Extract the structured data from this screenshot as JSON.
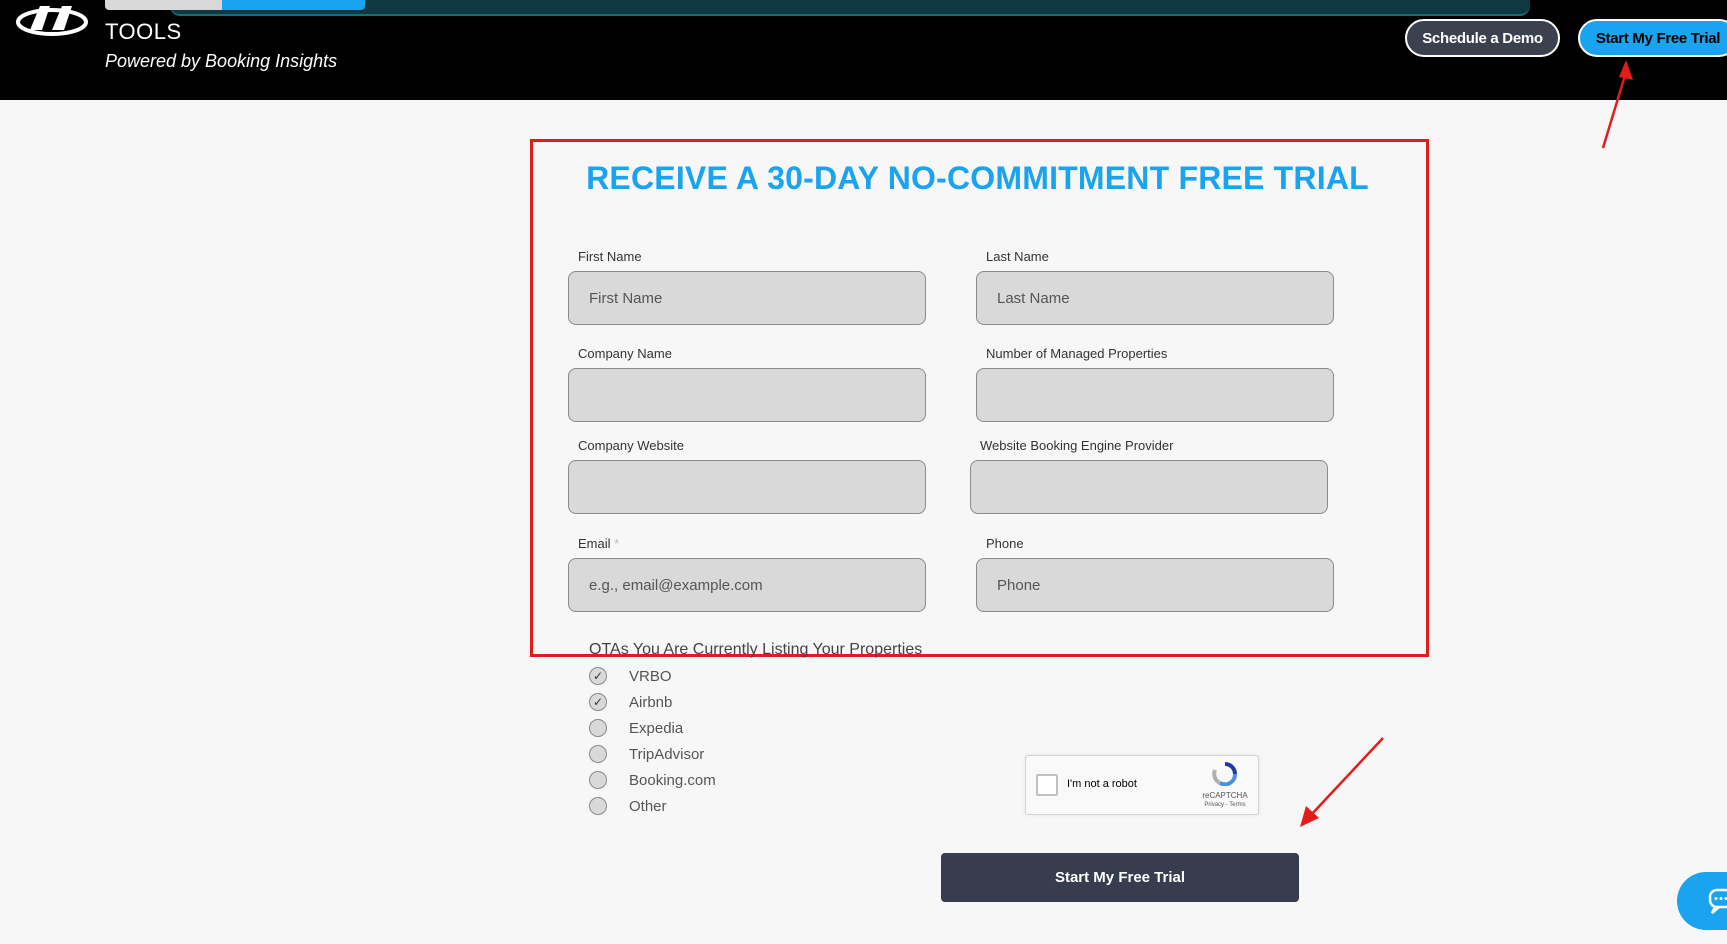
{
  "header": {
    "brand_tools": "TOOLS",
    "tagline": "Powered by Booking Insights",
    "schedule_demo_label": "Schedule a Demo",
    "start_trial_label": "Start My Free Trial"
  },
  "form": {
    "heading": "RECEIVE A 30-DAY NO-COMMITMENT FREE TRIAL",
    "fields": {
      "first_name": {
        "label": "First Name",
        "placeholder": "First Name",
        "value": ""
      },
      "last_name": {
        "label": "Last Name",
        "placeholder": "Last Name",
        "value": ""
      },
      "company_name": {
        "label": "Company Name",
        "placeholder": "",
        "value": ""
      },
      "managed_properties": {
        "label": "Number of Managed Properties",
        "placeholder": "",
        "value": ""
      },
      "company_website": {
        "label": "Company Website",
        "placeholder": "",
        "value": ""
      },
      "booking_engine": {
        "label": "Website Booking Engine Provider",
        "placeholder": "",
        "value": ""
      },
      "email": {
        "label": "Email",
        "required_mark": "*",
        "placeholder": "e.g., email@example.com",
        "value": ""
      },
      "phone": {
        "label": "Phone",
        "placeholder": "Phone",
        "value": ""
      }
    },
    "ota": {
      "title": "OTAs You Are Currently Listing Your Properties",
      "options": [
        {
          "label": "VRBO",
          "checked": true,
          "mark": "✓"
        },
        {
          "label": "Airbnb",
          "checked": true,
          "mark": "✓"
        },
        {
          "label": "Expedia",
          "checked": false,
          "mark": ""
        },
        {
          "label": "TripAdvisor",
          "checked": false,
          "mark": ""
        },
        {
          "label": "Booking.com",
          "checked": false,
          "mark": ""
        },
        {
          "label": "Other",
          "checked": false,
          "mark": ""
        }
      ]
    },
    "recaptcha": {
      "label": "I'm not a robot",
      "brand": "reCAPTCHA",
      "terms": "Privacy - Terms"
    },
    "submit_label": "Start My Free Trial"
  },
  "colors": {
    "accent": "#1aa3ee",
    "annotation": "#e31b1b",
    "submit": "#373c4e",
    "header_bg": "#000000"
  },
  "icons": {
    "logo": "brand-logo-icon",
    "check": "check-icon",
    "recaptcha": "recaptcha-icon",
    "chat": "chat-icon"
  }
}
